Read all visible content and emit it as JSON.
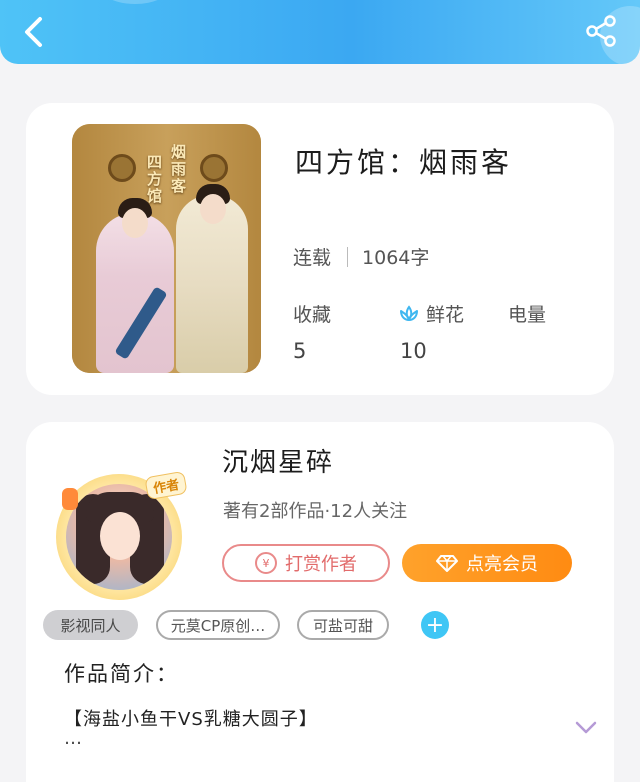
{
  "book": {
    "title": "四方馆：烟雨客",
    "cover": {
      "vertical_title_left": "四方馆",
      "vertical_title_right": "烟雨客"
    },
    "status": "连载",
    "word_count": "1064字",
    "stats": {
      "favorites": {
        "label": "收藏",
        "value": "5"
      },
      "flowers": {
        "label": "鲜花",
        "value": "10",
        "icon": "lotus-icon",
        "icon_color": "#3fb7f0"
      },
      "power": {
        "label": "电量",
        "value": ""
      }
    }
  },
  "author": {
    "name": "沉烟星碎",
    "meta": "著有2部作品·12人关注",
    "badge": "作者",
    "tip_button": "打赏作者",
    "tip_icon": "¥",
    "vip_button": "点亮会员",
    "vip_icon": "diamond-icon",
    "tags": [
      "影视同人",
      "元莫CP原创…",
      "可盐可甜"
    ],
    "add_tag_icon": "+"
  },
  "intro": {
    "label": "作品简介：",
    "text": "【海盐小鱼干VS乳糖大圆子】",
    "ellipsis": "…"
  },
  "colors": {
    "header_gradient": [
      "#4fc3f7",
      "#3ba8f2"
    ],
    "vip_orange": "#ff8b12",
    "tip_red": "#e26b6b",
    "add_tag_blue": "#3fc6f5",
    "expand_purple": "#b59ad6"
  }
}
